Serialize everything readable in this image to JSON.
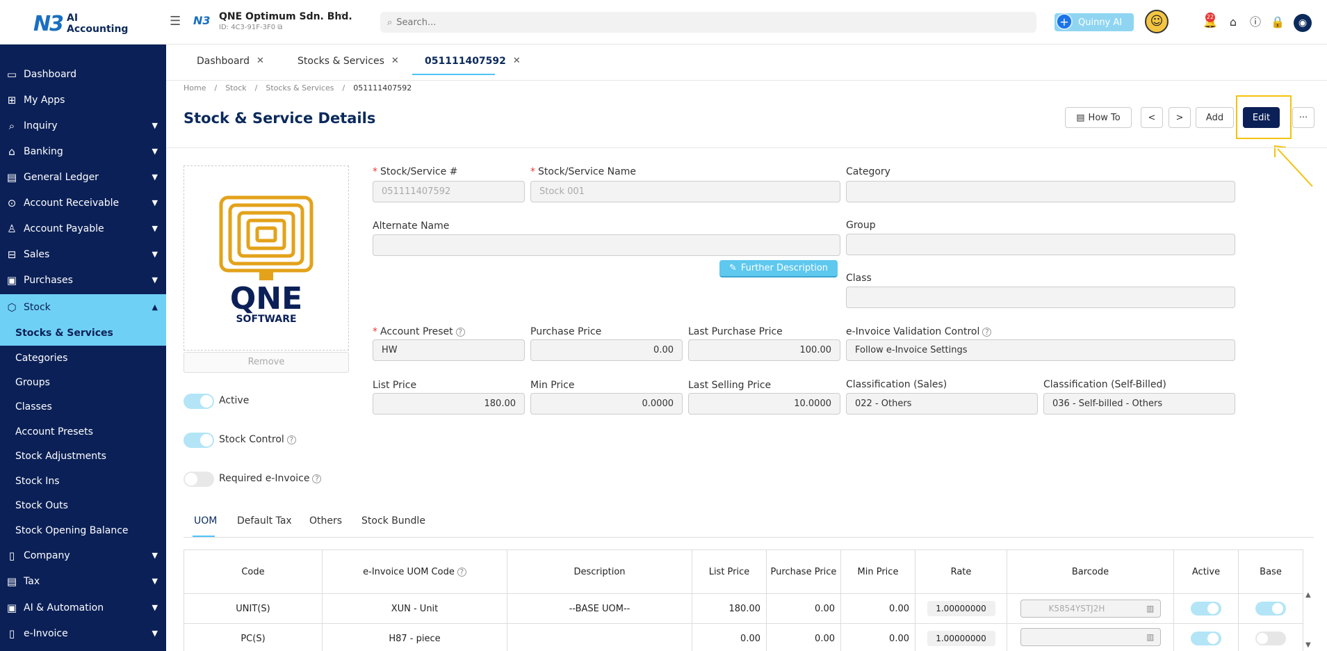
{
  "app": {
    "logo_mark": "N3",
    "logo_text": "AI Accounting"
  },
  "company": {
    "logo_mark": "N3",
    "name": "QNE Optimum Sdn. Bhd.",
    "id": "ID: 4C3-91F-3F0"
  },
  "search": {
    "placeholder": "Search..."
  },
  "quinny": {
    "label": "Quinny AI"
  },
  "notifications": {
    "count": "22"
  },
  "sidebar": {
    "items": [
      {
        "label": "Dashboard",
        "icon": "monitor-icon"
      },
      {
        "label": "My Apps",
        "icon": "grid-icon"
      },
      {
        "label": "Inquiry",
        "icon": "inquiry-icon"
      },
      {
        "label": "Banking",
        "icon": "bank-icon"
      },
      {
        "label": "General Ledger",
        "icon": "ledger-icon"
      },
      {
        "label": "Account Receivable",
        "icon": "receivable-icon"
      },
      {
        "label": "Account Payable",
        "icon": "payable-icon"
      },
      {
        "label": "Sales",
        "icon": "cart-icon"
      },
      {
        "label": "Purchases",
        "icon": "purchases-icon"
      },
      {
        "label": "Stock",
        "icon": "box-icon"
      }
    ],
    "stock_sub": [
      "Stocks & Services",
      "Categories",
      "Groups",
      "Classes",
      "Account Presets",
      "Stock Adjustments",
      "Stock Ins",
      "Stock Outs",
      "Stock Opening Balance"
    ],
    "bottom_items": [
      {
        "label": "Company",
        "icon": "book-icon"
      },
      {
        "label": "Tax",
        "icon": "tax-icon"
      },
      {
        "label": "AI & Automation",
        "icon": "automation-icon"
      },
      {
        "label": "e-Invoice",
        "icon": "document-icon"
      }
    ]
  },
  "tabs": [
    "Dashboard",
    "Stocks & Services",
    "051111407592"
  ],
  "breadcrumb": [
    "Home",
    "Stock",
    "Stocks & Services",
    "051111407592"
  ],
  "page": {
    "title": "Stock & Service Details"
  },
  "toolbar": {
    "howto": "How To",
    "prev": "<",
    "next": ">",
    "add": "Add",
    "edit": "Edit",
    "more": "···"
  },
  "image": {
    "brand": "QNE",
    "sub": "SOFTWARE",
    "remove": "Remove"
  },
  "toggles": {
    "active": "Active",
    "stock_control": "Stock Control",
    "required_einvoice": "Required e-Invoice"
  },
  "fields": {
    "stock_no": {
      "label": "Stock/Service #",
      "value": "051111407592"
    },
    "stock_name": {
      "label": "Stock/Service Name",
      "value": "Stock 001"
    },
    "category": {
      "label": "Category",
      "value": ""
    },
    "alt_name": {
      "label": "Alternate Name",
      "value": ""
    },
    "group": {
      "label": "Group",
      "value": ""
    },
    "further": "Further Description",
    "class": {
      "label": "Class",
      "value": ""
    },
    "account_preset": {
      "label": "Account Preset",
      "value": "HW"
    },
    "purchase_price": {
      "label": "Purchase Price",
      "value": "0.00"
    },
    "last_purchase_price": {
      "label": "Last Purchase Price",
      "value": "100.00"
    },
    "einv_validation": {
      "label": "e-Invoice Validation Control",
      "value": "Follow e-Invoice Settings"
    },
    "list_price": {
      "label": "List Price",
      "value": "180.00"
    },
    "min_price": {
      "label": "Min Price",
      "value": "0.0000"
    },
    "last_selling_price": {
      "label": "Last Selling Price",
      "value": "10.0000"
    },
    "class_sales": {
      "label": "Classification (Sales)",
      "value": "022 - Others"
    },
    "class_self": {
      "label": "Classification (Self-Billed)",
      "value": "036 - Self-billed - Others"
    }
  },
  "bottom_tabs": [
    "UOM",
    "Default Tax",
    "Others",
    "Stock Bundle"
  ],
  "uom_table": {
    "headers": [
      "Code",
      "e-Invoice UOM Code",
      "Description",
      "List Price",
      "Purchase Price",
      "Min Price",
      "Rate",
      "Barcode",
      "Active",
      "Base"
    ],
    "rows": [
      {
        "code": "UNIT(S)",
        "einv": "XUN - Unit",
        "desc": "--BASE UOM--",
        "list": "180.00",
        "purchase": "0.00",
        "min": "0.00",
        "rate": "1.00000000",
        "barcode": "K5854YSTJ2H",
        "active": true,
        "base": true
      },
      {
        "code": "PC(S)",
        "einv": "H87 - piece",
        "desc": "",
        "list": "0.00",
        "purchase": "0.00",
        "min": "0.00",
        "rate": "1.00000000",
        "barcode": "",
        "active": true,
        "base": false
      }
    ]
  },
  "colors": {
    "sidebar": "#0b2057",
    "accent": "#6fd0f5",
    "highlight": "#f4c20d"
  }
}
